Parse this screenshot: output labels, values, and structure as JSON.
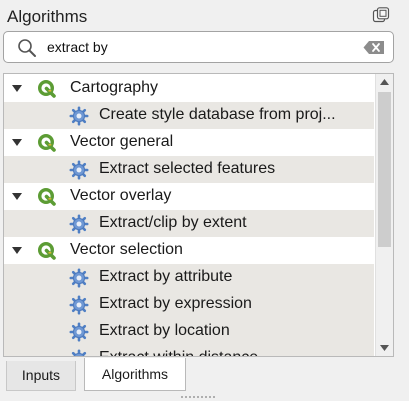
{
  "panel": {
    "title": "Algorithms"
  },
  "search": {
    "value": "extract by",
    "placeholder": ""
  },
  "tree": {
    "groups": [
      {
        "label": "Cartography",
        "expanded": true,
        "items": [
          {
            "label": "Create style database from proj..."
          }
        ]
      },
      {
        "label": "Vector general",
        "expanded": true,
        "items": [
          {
            "label": "Extract selected features"
          }
        ]
      },
      {
        "label": "Vector overlay",
        "expanded": true,
        "items": [
          {
            "label": "Extract/clip by extent"
          }
        ]
      },
      {
        "label": "Vector selection",
        "expanded": true,
        "items": [
          {
            "label": "Extract by attribute"
          },
          {
            "label": "Extract by expression"
          },
          {
            "label": "Extract by location"
          },
          {
            "label": "Extract within distance"
          }
        ]
      }
    ]
  },
  "tabs": [
    {
      "label": "Inputs",
      "active": false
    },
    {
      "label": "Algorithms",
      "active": true
    }
  ],
  "colors": {
    "qgis_green": "#5c9c34",
    "gear_blue": "#4f7fc4",
    "alt_row": "#e9e7e3"
  },
  "icons": {
    "float": "float-icon",
    "search": "search-icon",
    "clear": "clear-icon",
    "group": "qgis-logo-icon",
    "algorithm": "gear-icon"
  }
}
